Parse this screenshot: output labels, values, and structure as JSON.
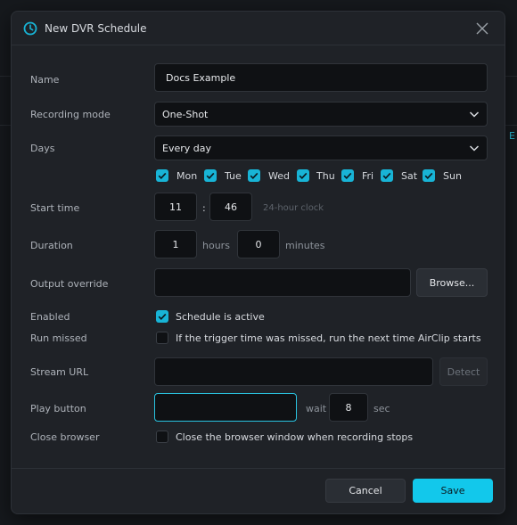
{
  "dialog": {
    "title": "New DVR Schedule",
    "background_accent_text": "E"
  },
  "form": {
    "name": {
      "label": "Name",
      "value": "Docs Example"
    },
    "recording_mode": {
      "label": "Recording mode",
      "value": "One-Shot"
    },
    "days": {
      "label": "Days",
      "value": "Every day",
      "checkboxes": [
        {
          "label": "Mon",
          "checked": true
        },
        {
          "label": "Tue",
          "checked": true
        },
        {
          "label": "Wed",
          "checked": true
        },
        {
          "label": "Thu",
          "checked": true
        },
        {
          "label": "Fri",
          "checked": true
        },
        {
          "label": "Sat",
          "checked": true
        },
        {
          "label": "Sun",
          "checked": true
        }
      ]
    },
    "start_time": {
      "label": "Start time",
      "hour": "11",
      "separator": ":",
      "minute": "46",
      "hint": "24-hour clock"
    },
    "duration": {
      "label": "Duration",
      "hours": "1",
      "hours_unit": "hours",
      "minutes": "0",
      "minutes_unit": "minutes"
    },
    "output_override": {
      "label": "Output override",
      "value": "",
      "browse_label": "Browse..."
    },
    "enabled": {
      "label": "Enabled",
      "checked": true,
      "text": "Schedule is active"
    },
    "run_missed": {
      "label": "Run missed",
      "checked": false,
      "text": "If the trigger time was missed, run the next time AirClip starts"
    },
    "stream_url": {
      "label": "Stream URL",
      "value": "",
      "detect_label": "Detect"
    },
    "play_button": {
      "label": "Play button",
      "value": "",
      "wait_label": "wait",
      "wait_value": "8",
      "wait_unit": "sec"
    },
    "close_browser": {
      "label": "Close browser",
      "checked": false,
      "text": "Close the browser window when recording stops"
    }
  },
  "footer": {
    "cancel_label": "Cancel",
    "save_label": "Save"
  },
  "colors": {
    "accent": "#12c8eb",
    "checkbox": "#18b4d6",
    "background": "#1f2227"
  },
  "icons": {
    "title": "clock-icon",
    "close": "close-icon",
    "dropdown": "chevron-down-icon",
    "check": "checkmark-icon"
  }
}
